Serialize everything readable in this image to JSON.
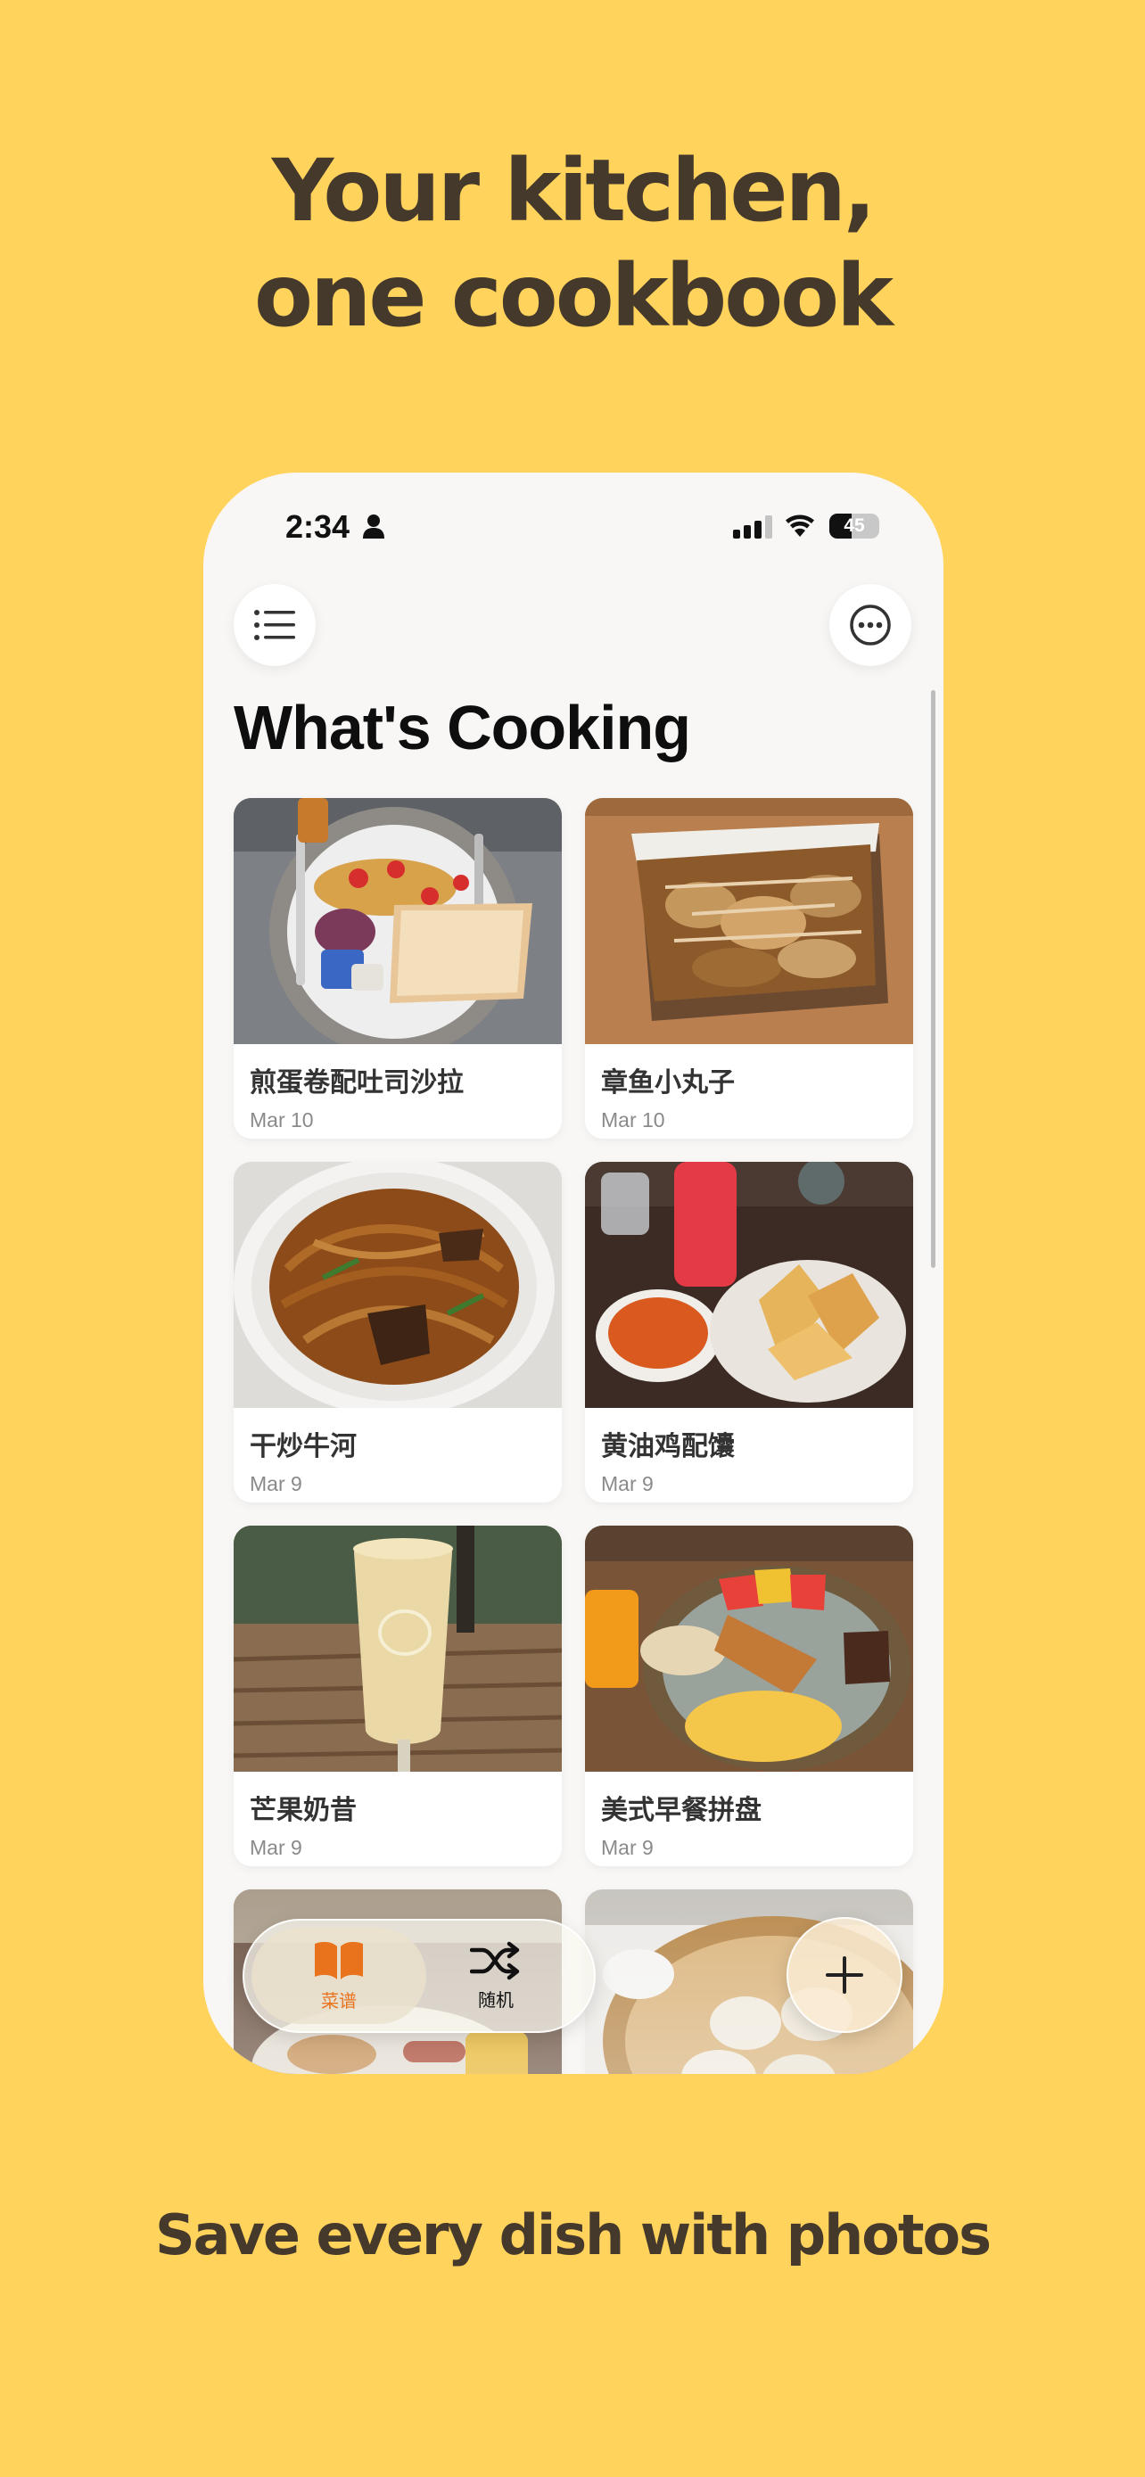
{
  "headline": {
    "line1": "Your kitchen,",
    "line2": "one cookbook"
  },
  "tagline": "Save every dish with photos",
  "status_bar": {
    "time": "2:34",
    "battery": "45"
  },
  "page_title": "What's Cooking",
  "icons": {
    "menu": "list-icon",
    "more": "ellipsis-circle-icon",
    "recipes_tab": "book-icon",
    "random_tab": "shuffle-icon",
    "add": "plus-icon"
  },
  "recipes": [
    {
      "name": "煎蛋卷配吐司沙拉",
      "date": "Mar 10",
      "photo": "omelette-toast-salad-photo"
    },
    {
      "name": "章鱼小丸子",
      "date": "Mar 10",
      "photo": "takoyaki-photo"
    },
    {
      "name": "干炒牛河",
      "date": "Mar 9",
      "photo": "beef-chow-fun-photo"
    },
    {
      "name": "黄油鸡配馕",
      "date": "Mar 9",
      "photo": "butter-chicken-naan-photo"
    },
    {
      "name": "芒果奶昔",
      "date": "Mar 9",
      "photo": "mango-smoothie-photo"
    },
    {
      "name": "美式早餐拼盘",
      "date": "Mar 9",
      "photo": "american-breakfast-photo"
    }
  ],
  "tabbar": {
    "recipes_label": "菜谱",
    "random_label": "随机"
  },
  "colors": {
    "background": "#FFD35C",
    "headline": "#45392b",
    "accent": "#E8731C"
  }
}
